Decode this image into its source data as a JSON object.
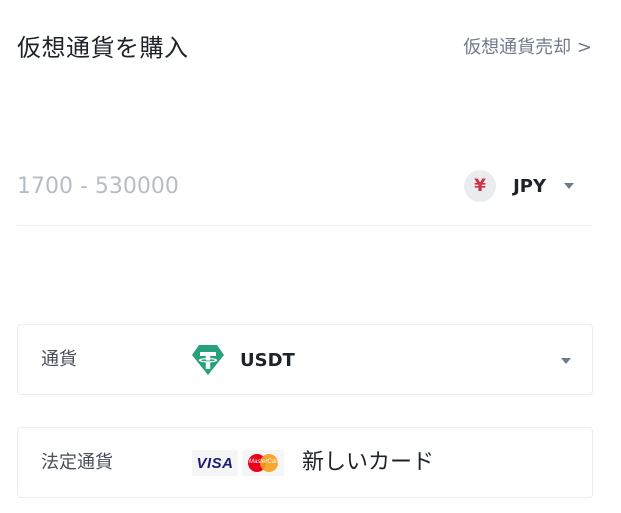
{
  "header": {
    "title": "仮想通貨を購入",
    "sell_link": "仮想通貨売却 >"
  },
  "amount": {
    "placeholder": "1700 - 530000",
    "value": "",
    "currency_symbol": "¥",
    "currency_code": "JPY",
    "currency_icon": "yen-icon"
  },
  "crypto": {
    "label": "通貨",
    "coin_code": "USDT",
    "coin_icon": "tether-icon"
  },
  "fiat": {
    "label": "法定通貨",
    "card_brands": [
      "visa",
      "mastercard"
    ],
    "visa_label": "VISA",
    "mastercard_label": "MasterCard",
    "payment_text": "新しいカード"
  },
  "colors": {
    "text_primary": "#1e2329",
    "text_secondary": "#707a8a",
    "placeholder": "#b7bdc6",
    "border": "#eaecef",
    "yen": "#cf304a",
    "tether": "#26a17b"
  }
}
